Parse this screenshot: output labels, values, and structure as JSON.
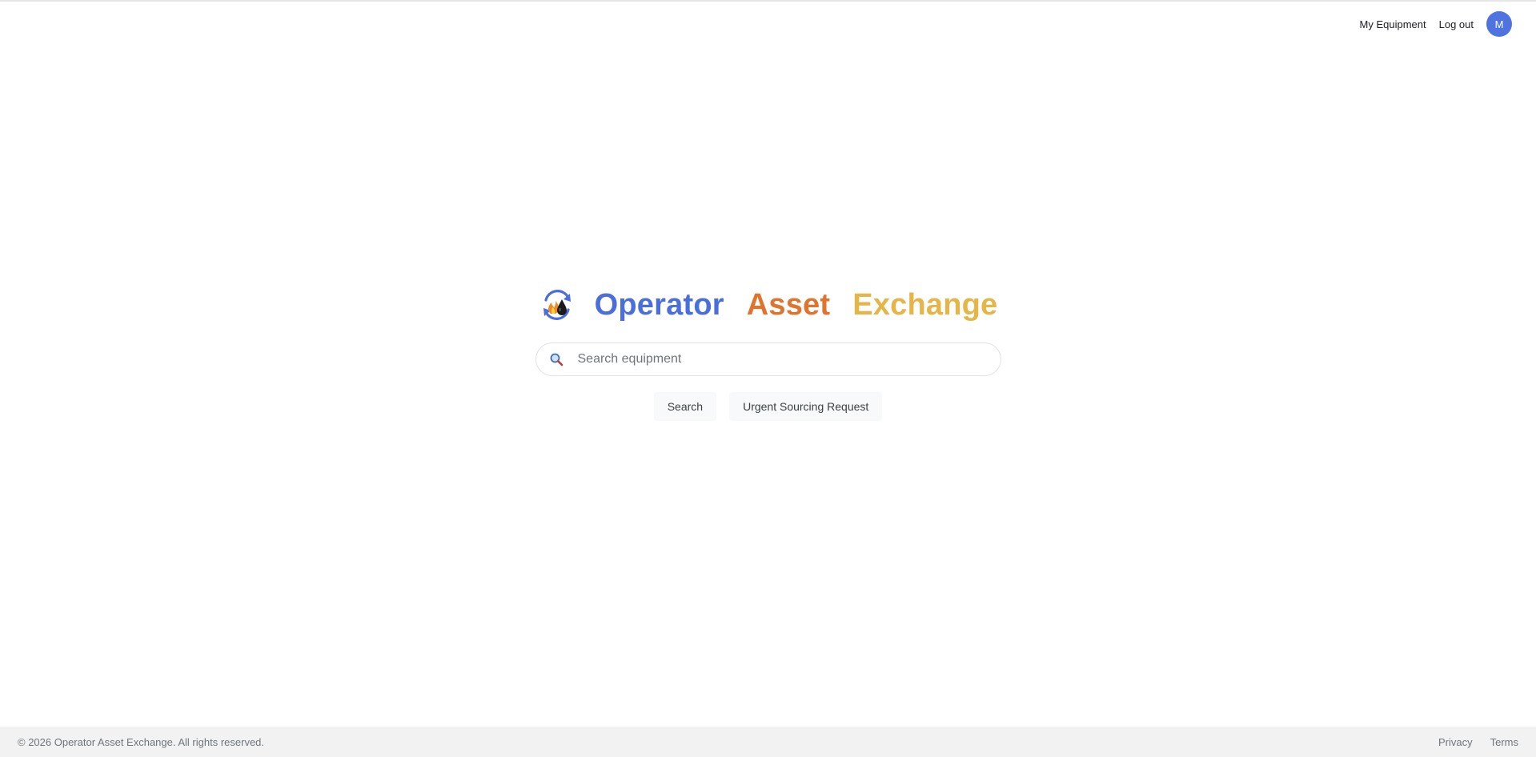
{
  "header": {
    "my_equipment_label": "My Equipment",
    "logout_label": "Log out",
    "avatar_initial": "M"
  },
  "brand": {
    "logo_icon": "flame-droplet-cycle-icon",
    "words": [
      {
        "text": "Operator",
        "color": "#4a6fdc"
      },
      {
        "text": "Asset",
        "color": "#e0742e"
      },
      {
        "text": "Exchange",
        "color": "#e6b547"
      }
    ]
  },
  "search": {
    "icon": "search-icon",
    "placeholder": "Search equipment",
    "value": ""
  },
  "actions": {
    "search_label": "Search",
    "urgent_label": "Urgent Sourcing Request"
  },
  "footer": {
    "copyright": "© 2026 Operator Asset Exchange. All rights reserved.",
    "privacy_label": "Privacy",
    "terms_label": "Terms"
  },
  "colors": {
    "accent": "#4f73e0",
    "button_bg": "#f8f9fa",
    "footer_bg": "#f2f2f2"
  }
}
